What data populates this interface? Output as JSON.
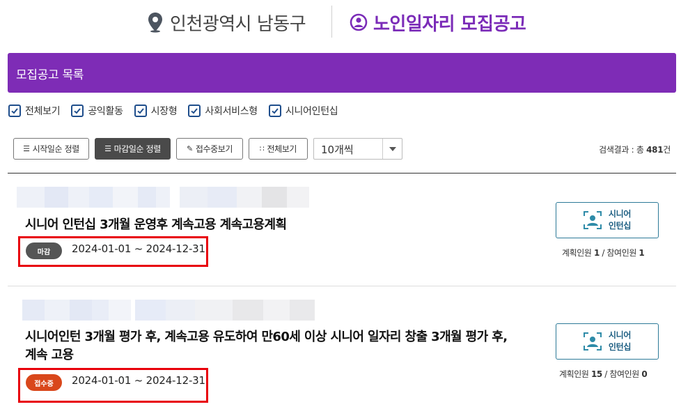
{
  "header": {
    "region": "인천광역시 남동구",
    "title": "노인일자리 모집공고"
  },
  "banner": {
    "title": "모집공고 목록"
  },
  "filters": [
    {
      "label": "전체보기",
      "checked": true
    },
    {
      "label": "공익활동",
      "checked": true
    },
    {
      "label": "시장형",
      "checked": true
    },
    {
      "label": "사회서비스형",
      "checked": true
    },
    {
      "label": "시니어인턴십",
      "checked": true
    }
  ],
  "toolbar": {
    "sort_start": "시작일순 정렬",
    "sort_end": "마감일순 정렬",
    "open_only": "접수중보기",
    "show_all": "전체보기",
    "page_size": "10개씩"
  },
  "result": {
    "prefix": "검색결과 : 총 ",
    "count": "481",
    "suffix": "건"
  },
  "posts": [
    {
      "title": "시니어 인턴십 3개월 운영후 계속고용 계속고용계획",
      "status": "마감",
      "dates": "2024-01-01 ~ 2024-12-31",
      "type_line1": "시니어",
      "type_line2": "인턴십",
      "planned_label": "계획인원 ",
      "planned": "1",
      "separator": " / ",
      "joined_label": "참여인원 ",
      "joined": "1"
    },
    {
      "title_line1": "시니어인턴 3개월 평가 후, 계속고용 유도하여 만60세 이상 시니어 일자리 창출 3개월 평가 후,",
      "title_line2": "계속 고용",
      "status": "접수중",
      "dates": "2024-01-01 ~ 2024-12-31",
      "type_line1": "시니어",
      "type_line2": "인턴십",
      "planned_label": "계획인원 ",
      "planned": "15",
      "separator": " / ",
      "joined_label": "참여인원 ",
      "joined": "0"
    }
  ],
  "colors": {
    "brand_purple": "#7e2cb6",
    "badge_closed": "#555555",
    "badge_open": "#d9471b",
    "highlight_red": "#e8000b",
    "type_teal": "#2d7a98"
  }
}
